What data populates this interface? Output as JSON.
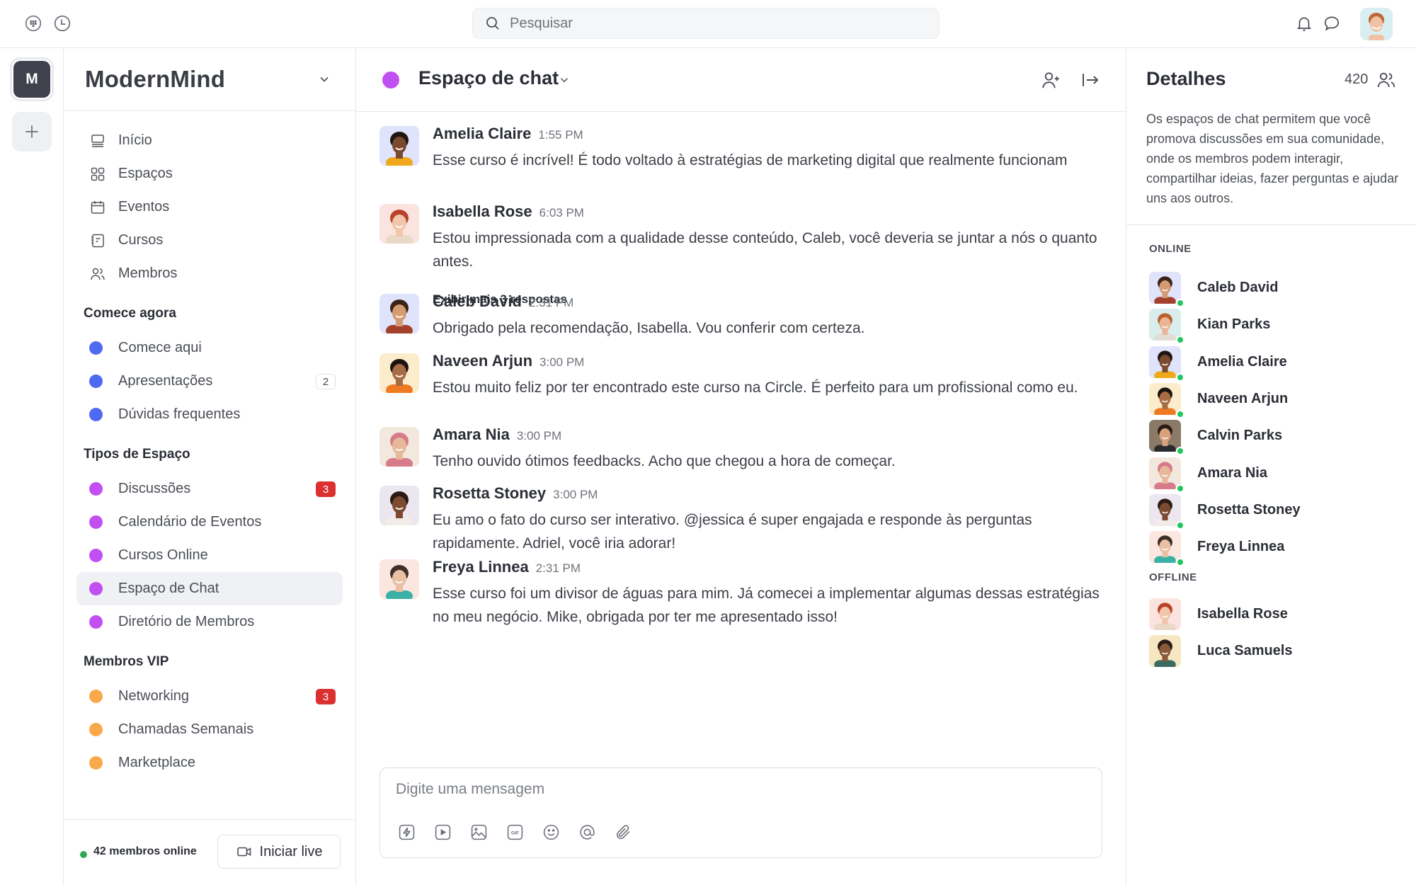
{
  "topbar": {
    "search_placeholder": "Pesquisar",
    "left_icons": [
      "apps-grid-icon",
      "clock-history-icon"
    ],
    "right_icons": [
      "bell-icon",
      "chat-bubble-icon"
    ]
  },
  "rail": {
    "workspace_initial": "M",
    "add_label": "+"
  },
  "sidebar": {
    "community_name": "ModernMind",
    "nav": [
      {
        "label": "Início",
        "icon": "home-icon"
      },
      {
        "label": "Espaços",
        "icon": "grid-icon"
      },
      {
        "label": "Eventos",
        "icon": "calendar-icon"
      },
      {
        "label": "Cursos",
        "icon": "notebook-icon"
      },
      {
        "label": "Membros",
        "icon": "members-icon"
      }
    ],
    "sections": [
      {
        "title": "Comece agora",
        "color": "#4e6af0",
        "items": [
          {
            "label": "Comece aqui"
          },
          {
            "label": "Apresentações",
            "badge": "2",
            "badge_style": "outline"
          },
          {
            "label": "Dúvidas frequentes"
          }
        ]
      },
      {
        "title": "Tipos de Espaço",
        "color": "#c14ff2",
        "items": [
          {
            "label": "Discussões",
            "badge": "3",
            "badge_style": "red"
          },
          {
            "label": "Calendário de Eventos"
          },
          {
            "label": "Cursos Online"
          },
          {
            "label": "Espaço de Chat",
            "active": true
          },
          {
            "label": "Diretório de Membros"
          }
        ]
      },
      {
        "title": "Membros VIP",
        "color": "#f9a84a",
        "items": [
          {
            "label": "Networking",
            "badge": "3",
            "badge_style": "red"
          },
          {
            "label": "Chamadas Semanais"
          },
          {
            "label": "Marketplace"
          }
        ]
      }
    ],
    "footer": {
      "online_text": "42 membros online",
      "live_button": "Iniciar live"
    }
  },
  "chat": {
    "space_title": "Espaço de chat",
    "space_color": "#c14ff2",
    "messages": [
      {
        "author": "Amelia Claire",
        "time": "1:55 PM",
        "text": "Esse curso é incrível! É todo voltado à estratégias de marketing digital que realmente funcionam",
        "avatar_bg": "#dfe3fb",
        "skin": "#7a4a2e",
        "hair": "#1f1612",
        "shirt": "#f0a81c"
      },
      {
        "author": "Isabella Rose",
        "time": "6:03 PM",
        "text": "Estou impressionada com a qualidade desse conteúdo, Caleb, você deveria se juntar a nós o quanto antes.",
        "replies": "Exibir mais 3 respostas",
        "avatar_bg": "#fbe4df",
        "skin": "#f1c6aa",
        "hair": "#b8432a",
        "shirt": "#e9d9c7"
      },
      {
        "author": "Caleb David",
        "time": "2:31 PM",
        "text": "Obrigado pela recomendação, Isabella. Vou conferir com certeza.",
        "avatar_bg": "#dfe3fb",
        "skin": "#d49a72",
        "hair": "#3a2418",
        "shirt": "#a4412c"
      },
      {
        "author": "Naveen Arjun",
        "time": "3:00 PM",
        "text": "Estou muito feliz por ter encontrado este curso na Circle. É perfeito para um profissional como eu.",
        "avatar_bg": "#fbeccb",
        "skin": "#a86c45",
        "hair": "#1c1410",
        "shirt": "#f07a22"
      },
      {
        "author": "Amara Nia",
        "time": "3:00 PM",
        "text": "Tenho ouvido ótimos feedbacks. Acho que chegou a hora de começar.",
        "avatar_bg": "#f3e8dd",
        "skin": "#e6b99a",
        "hair": "#d77a8a",
        "shirt": "#d77a8a"
      },
      {
        "author": "Rosetta Stoney",
        "time": "3:00 PM",
        "text": "Eu amo o fato do curso ser interativo. @jessica é super engajada e responde às perguntas rapidamente. Adriel, você iria adorar!",
        "avatar_bg": "#ece6f0",
        "skin": "#7b4a30",
        "hair": "#2a1a12",
        "shirt": "#f2ece8"
      },
      {
        "author": "Freya Linnea",
        "time": "2:31 PM",
        "text": "Esse curso foi um divisor de águas para mim. Já comecei a implementar algumas dessas estratégias no meu negócio. Mike, obrigada por ter me apresentado isso!",
        "avatar_bg": "#fbe6e0",
        "skin": "#e9c0a3",
        "hair": "#3d3028",
        "shirt": "#3bb1a6"
      }
    ],
    "composer_placeholder": "Digite uma mensagem",
    "composer_tools": [
      "lightning-icon",
      "video-play-icon",
      "image-icon",
      "gif-icon",
      "emoji-icon",
      "mention-icon",
      "paperclip-icon"
    ]
  },
  "details": {
    "title": "Detalhes",
    "member_count": "420",
    "description": "Os espaços de chat permitem que você promova discussões em sua comunidade, onde os membros podem interagir, compartilhar ideias, fazer perguntas e ajudar uns aos outros.",
    "online_label": "ONLINE",
    "offline_label": "OFFLINE",
    "online": [
      {
        "name": "Caleb David",
        "avatar_bg": "#dfe3fb",
        "skin": "#d49a72",
        "hair": "#3a2418",
        "shirt": "#a4412c"
      },
      {
        "name": "Kian Parks",
        "avatar_bg": "#d9eeec",
        "skin": "#eab596",
        "hair": "#b8622c",
        "shirt": "#e2ddd4"
      },
      {
        "name": "Amelia Claire",
        "avatar_bg": "#dfe3fb",
        "skin": "#7a4a2e",
        "hair": "#1f1612",
        "shirt": "#f0a81c"
      },
      {
        "name": "Naveen Arjun",
        "avatar_bg": "#fbeccb",
        "skin": "#a86c45",
        "hair": "#1c1410",
        "shirt": "#f07a22"
      },
      {
        "name": "Calvin Parks",
        "avatar_bg": "#8c7a68",
        "skin": "#d9a27c",
        "hair": "#2a1c14",
        "shirt": "#2b2b2e"
      },
      {
        "name": "Amara Nia",
        "avatar_bg": "#f3e8dd",
        "skin": "#e6b99a",
        "hair": "#d77a8a",
        "shirt": "#d77a8a"
      },
      {
        "name": "Rosetta Stoney",
        "avatar_bg": "#ece6f0",
        "skin": "#7b4a30",
        "hair": "#2a1a12",
        "shirt": "#f2ece8"
      },
      {
        "name": "Freya Linnea",
        "avatar_bg": "#fbe6e0",
        "skin": "#e9c0a3",
        "hair": "#3d3028",
        "shirt": "#3bb1a6"
      }
    ],
    "offline": [
      {
        "name": "Isabella Rose",
        "avatar_bg": "#fbe4df",
        "skin": "#f1c6aa",
        "hair": "#b8432a",
        "shirt": "#e9d9c7"
      },
      {
        "name": "Luca Samuels",
        "avatar_bg": "#f6e6c2",
        "skin": "#8a5a3a",
        "hair": "#2a1c14",
        "shirt": "#3b6b5e"
      }
    ]
  }
}
